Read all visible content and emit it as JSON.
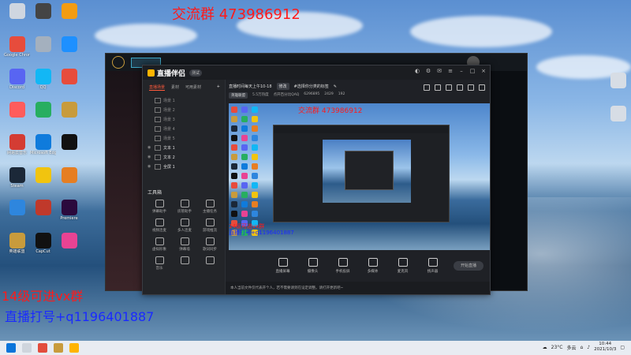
{
  "overlay": {
    "group_text": "交流群 473986912",
    "vx_text": "14级可进vx群",
    "qq_text": "直播打号+q1196401887"
  },
  "desktop_icons": [
    {
      "label": "",
      "color": "#cfd6e0"
    },
    {
      "label": "Google Chrome",
      "color": "#e74c3c"
    },
    {
      "label": "Discord",
      "color": "#5865f2"
    },
    {
      "label": "",
      "color": "#ff5c5c"
    },
    {
      "label": "网易云音乐",
      "color": "#d43c33"
    },
    {
      "label": "Steam",
      "color": "#1b2838"
    },
    {
      "label": "",
      "color": "#2e86de"
    },
    {
      "label": "英雄联盟",
      "color": "#c89b3c"
    },
    {
      "label": "",
      "color": "#444"
    },
    {
      "label": "",
      "color": "#a4b0be"
    },
    {
      "label": "QQ",
      "color": "#12b7f5"
    },
    {
      "label": "",
      "color": "#27ae60"
    },
    {
      "label": "Microsoft Edge",
      "color": "#0f7bdc"
    },
    {
      "label": "",
      "color": "#f1c40f"
    },
    {
      "label": "",
      "color": "#c0392b"
    },
    {
      "label": "CapCut",
      "color": "#111"
    },
    {
      "label": "",
      "color": "#f39c12"
    },
    {
      "label": "",
      "color": "#1e90ff"
    },
    {
      "label": "",
      "color": "#e74c3c"
    },
    {
      "label": "",
      "color": "#c89b3c"
    },
    {
      "label": "",
      "color": "#111"
    },
    {
      "label": "",
      "color": "#e67e22"
    },
    {
      "label": "Premiere",
      "color": "#2b0a3d"
    },
    {
      "label": "",
      "color": "#e84393"
    }
  ],
  "app": {
    "logo": "直播伴侣",
    "version": "测试",
    "tabs": [
      "直播场景",
      "素材",
      "可用素材"
    ],
    "scenes": [
      "场景 1",
      "场景 2",
      "场景 3",
      "场景 4",
      "场景 5"
    ],
    "scenes_visible": [
      "文本 1",
      "文本 2",
      "全屏 1"
    ],
    "tools_title": "工具箱",
    "tools": [
      "弹幕助手",
      "房管助手",
      "主播任务",
      "视频连麦",
      "多人连麦",
      "游戏推流",
      "虚拟形象",
      "弹幕墙",
      "歌词同步",
      "音乐",
      "",
      ""
    ],
    "title": "直播时间每天上午10-18",
    "edit_btn": "修改",
    "category": "#选择你分类的标签",
    "meta": [
      "英雄联盟",
      "5.5万热度",
      "点开百分比QAQ",
      "6296895",
      "2429",
      "192"
    ],
    "preview_overlay": "交流群 473986912",
    "bottom_buttons": [
      "直播屏幕",
      "摄像头",
      "手机投屏",
      "多媒体",
      "麦克风",
      "扬声器"
    ],
    "start_button": "开始直播",
    "status_text": "本人当前文件仅代表开个人，若不需要请到在设定调整。请打开更新吧~"
  },
  "taskbar": {
    "temp": "23°C",
    "weather": "多云",
    "time": "10:44",
    "date": "2021/10/3"
  }
}
